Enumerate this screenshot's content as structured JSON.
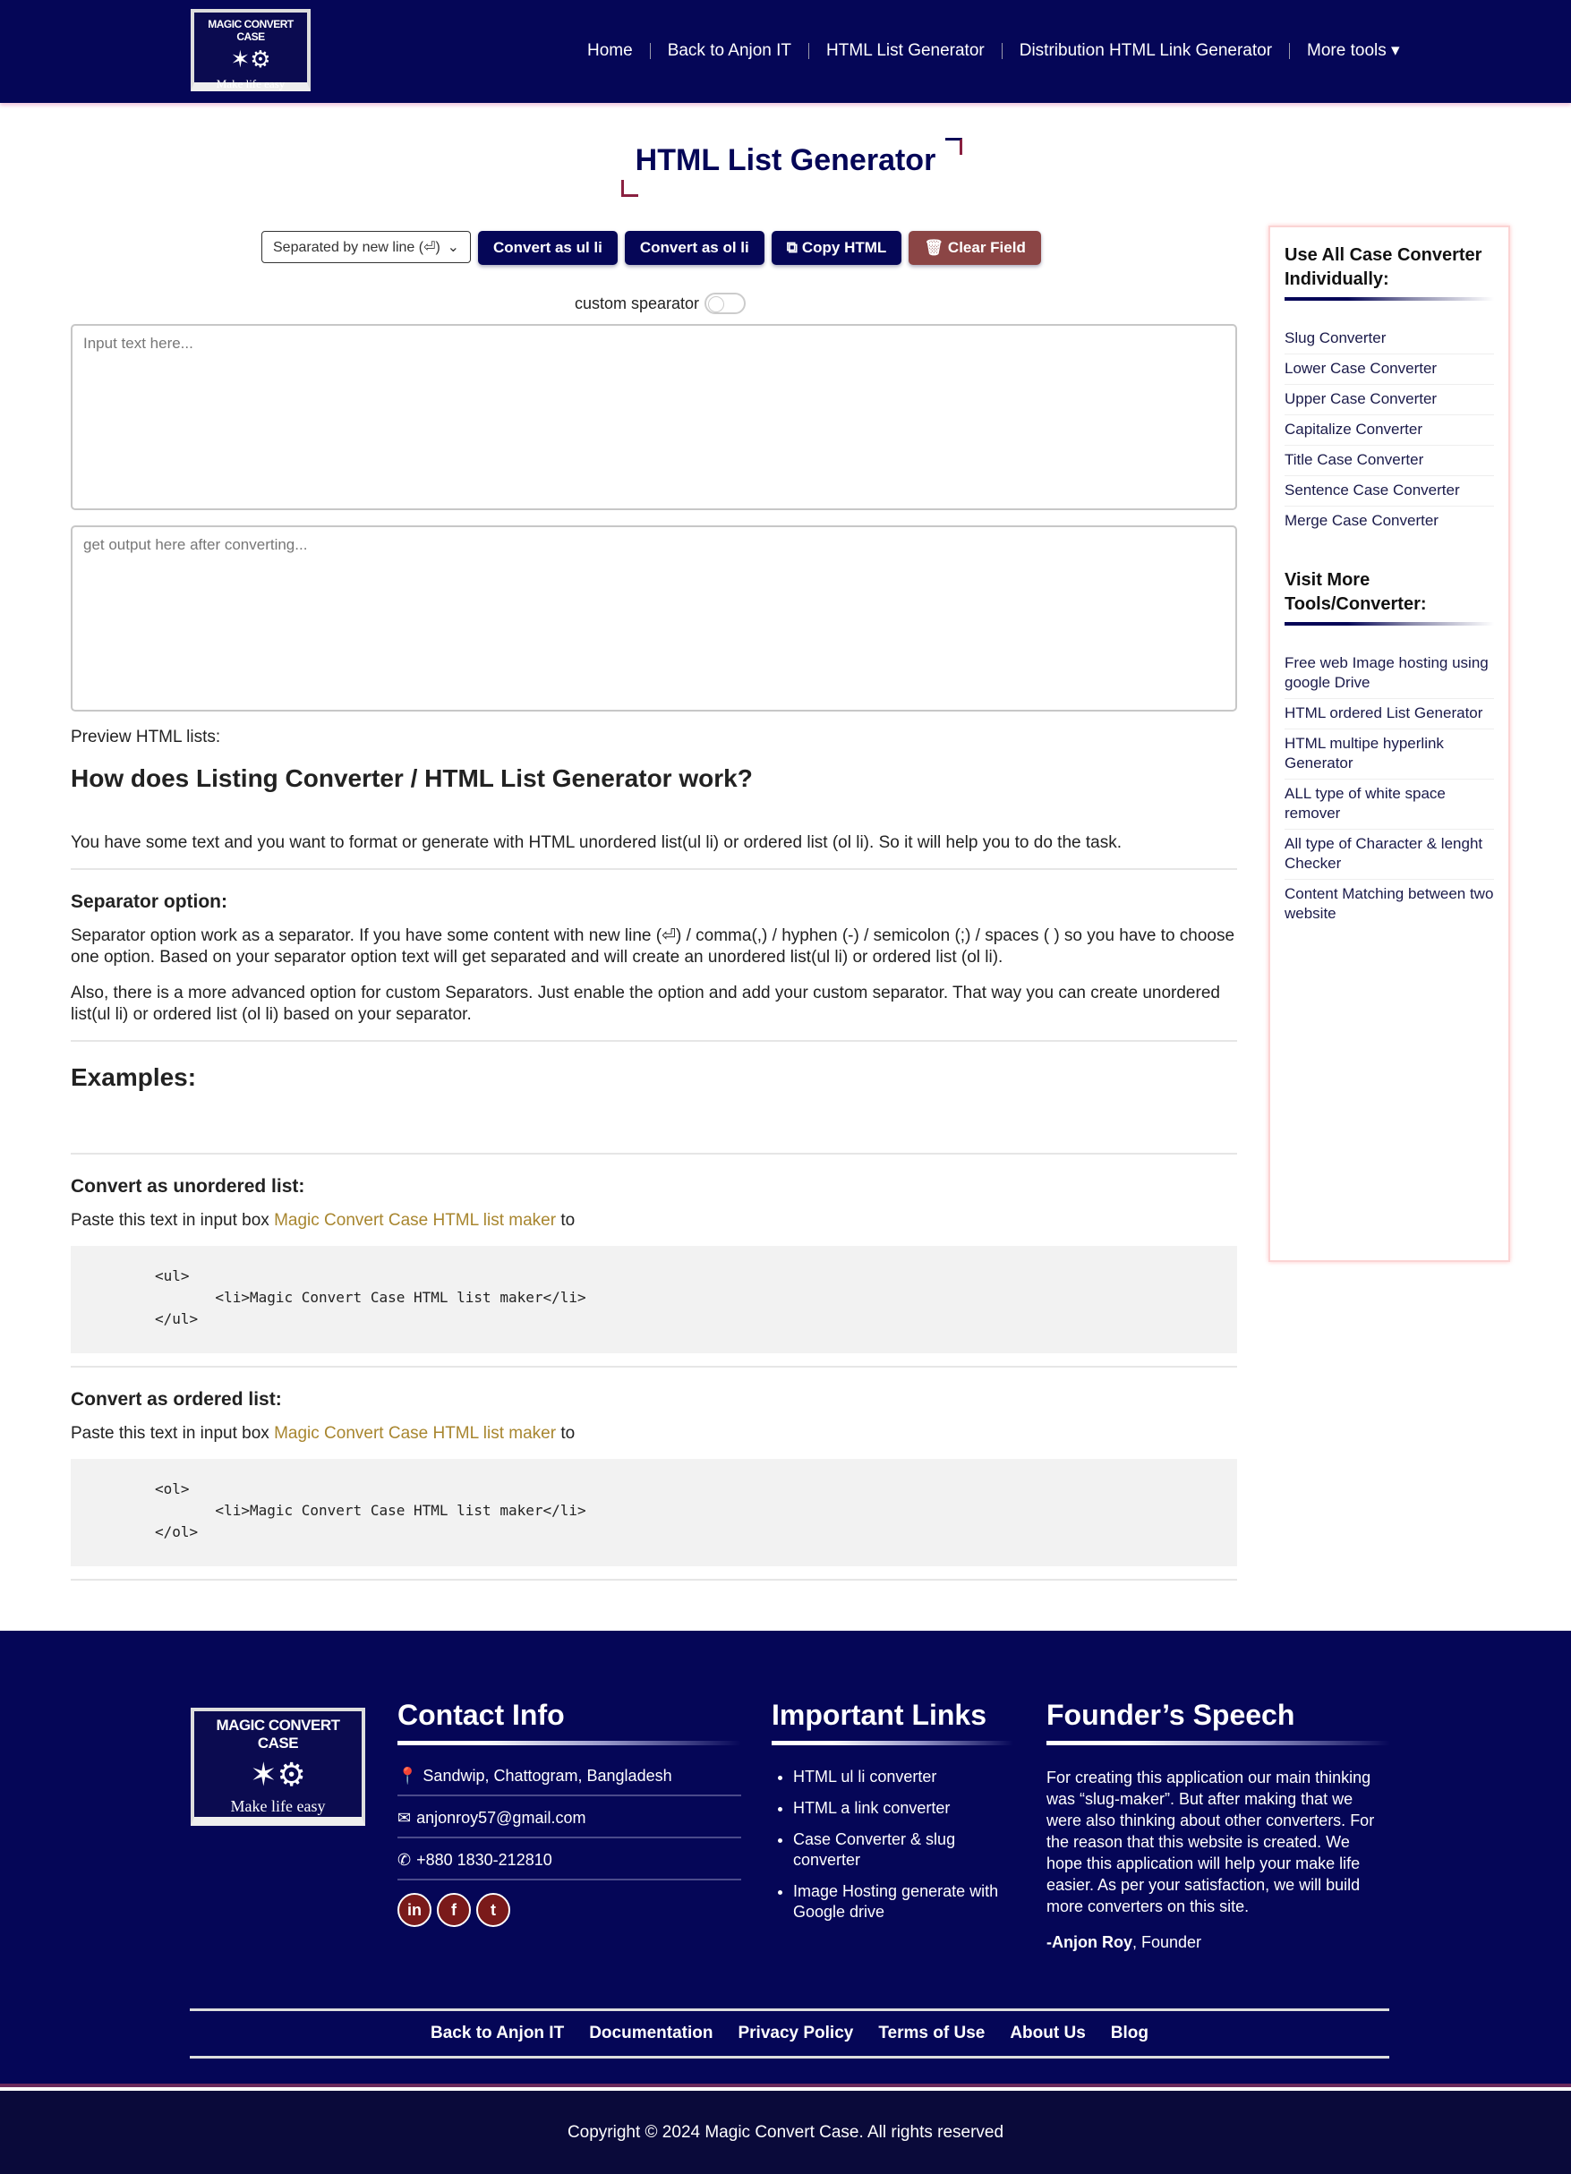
{
  "header": {
    "logo_text": "MAGIC CONVERT CASE",
    "logo_tagline": "Make life easy",
    "nav": [
      "Home",
      "Back to Anjon IT",
      "HTML List Generator",
      "Distribution HTML Link Generator",
      "More tools"
    ]
  },
  "page_title": "HTML List Generator",
  "toolbar": {
    "separator_select": "Separated by new line (⏎)",
    "convert_ul": "Convert as ul li",
    "convert_ol": "Convert as ol li",
    "copy_html": "Copy HTML",
    "clear_field": "Clear Field",
    "custom_separator_label": "custom spearator",
    "custom_separator_on": false
  },
  "input": {
    "placeholder": "Input text here...",
    "value": ""
  },
  "output": {
    "placeholder": "get output here after converting...",
    "value": ""
  },
  "main": {
    "preview_label": "Preview HTML lists:",
    "heading": "How does Listing Converter / HTML List Generator work?",
    "intro": "You have some text and you want to format or generate with HTML unordered list(ul li) or ordered list (ol li). So it will help you to do the task.",
    "separator_heading": "Separator option:",
    "separator_p1": "Separator option work as a separator. If you have some content with new line (⏎) / comma(,) / hyphen (-) / semicolon (;) / spaces ( ) so you have to choose one option. Based on your separator option text will get separated and will create an unordered list(ul li) or ordered list (ol li).",
    "separator_p2": "Also, there is a more advanced option for custom Separators. Just enable the option and add your custom separator. That way you can create unordered list(ul li) or ordered list (ol li) based on your separator.",
    "examples_heading": "Examples:",
    "ul_heading": "Convert as unordered list:",
    "paste_prefix": "Paste this text in input box ",
    "paste_link": "Magic Convert Case HTML list maker",
    "paste_suffix": " to",
    "ul_code": "<ul>\n       <li>Magic Convert Case HTML list maker</li>\n</ul>",
    "ol_heading": "Convert as ordered list:",
    "ol_code": "<ol>\n       <li>Magic Convert Case HTML list maker</li>\n</ol>"
  },
  "sidebar": {
    "heading1": "Use All Case Converter Individually:",
    "links1": [
      "Slug Converter",
      "Lower Case Converter",
      "Upper Case Converter",
      "Capitalize Converter",
      "Title Case Converter",
      "Sentence Case Converter",
      "Merge Case Converter"
    ],
    "heading2": "Visit More Tools/Converter:",
    "links2": [
      "Free web Image hosting using google Drive",
      "HTML ordered List Generator",
      "HTML multipe hyperlink Generator",
      "ALL type of white space remover",
      "All type of Character & lenght Checker",
      "Content Matching between two website"
    ]
  },
  "footer": {
    "contact_heading": "Contact Info",
    "address": "Sandwip, Chattogram, Bangladesh",
    "email": "anjonroy57@gmail.com",
    "phone": "+880 1830-212810",
    "social": [
      "linkedin",
      "facebook",
      "twitter"
    ],
    "links_heading": "Important Links",
    "links": [
      "HTML ul li converter",
      "HTML a link converter",
      "Case Converter & slug converter",
      "Image Hosting generate with Google drive"
    ],
    "speech_heading": "Founder’s Speech",
    "speech": "For creating this application our main thinking was “slug-maker”. But after making that we were also thinking about other converters. For the reason that this website is created. We hope this application will help your make life easier. As per your satisfaction, we will build more converters on this site.",
    "founder_name": "-Anjon Roy",
    "founder_title": ", Founder",
    "bottom_links": [
      "Back to Anjon IT",
      "Documentation",
      "Privacy Policy",
      "Terms of Use",
      "About Us",
      "Blog"
    ],
    "copyright": "Copyright © 2024 Magic Convert Case. All rights reserved"
  },
  "colors": {
    "primary": "#050657",
    "clear_button": "#8b4545",
    "link": "#a8862f"
  }
}
